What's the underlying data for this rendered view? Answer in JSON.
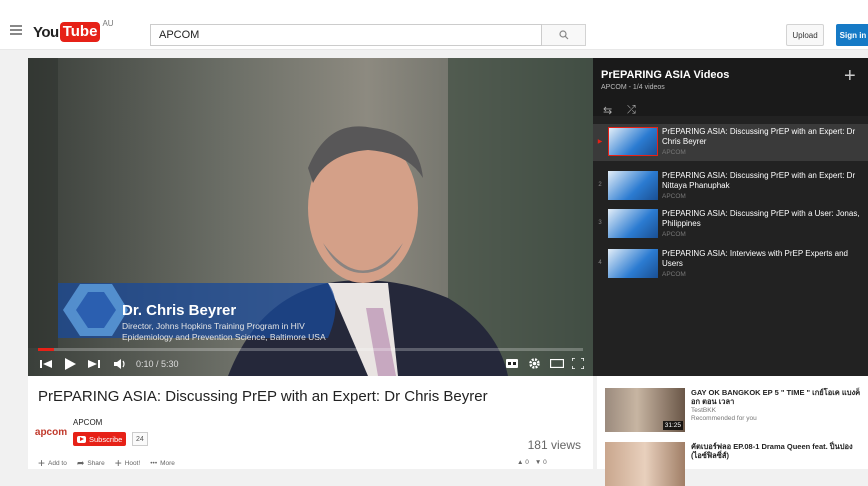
{
  "header": {
    "logo_you": "You",
    "logo_tube": "Tube",
    "country": "AU",
    "search_value": "APCOM",
    "upload_label": "Upload",
    "signin_label": "Sign in"
  },
  "player": {
    "time": "0:10 / 5:30",
    "progress_fraction": 0.03,
    "lower_third_name": "Dr. Chris Beyrer",
    "lower_third_sub": "Director, Johns Hopkins Training Program in HIV Epidemiology and Prevention Science, Baltimore USA"
  },
  "playlist": {
    "title": "PrEPARING ASIA Videos",
    "subtitle": "APCOM - 1/4 videos",
    "items": [
      {
        "index": "▶",
        "title": "PrEPARING ASIA: Discussing PrEP with an Expert: Dr Chris Beyrer",
        "channel": "APCOM"
      },
      {
        "index": "2",
        "title": "PrEPARING ASIA: Discussing PrEP with an Expert: Dr Nittaya Phanuphak",
        "channel": "APCOM"
      },
      {
        "index": "3",
        "title": "PrEPARING ASIA: Discussing PrEP with a User: Jonas, Philippines",
        "channel": "APCOM"
      },
      {
        "index": "4",
        "title": "PrEPARING ASIA: Interviews with PrEP Experts and Users",
        "channel": "APCOM"
      }
    ]
  },
  "video": {
    "title": "PrEPARING ASIA: Discussing PrEP with an Expert: Dr Chris Beyrer",
    "channel_logo": "apcom",
    "channel_name": "APCOM",
    "subscribe_label": "Subscribe",
    "subscriber_count": "24",
    "views": "181 views",
    "actions": [
      "Add to",
      "Share",
      "Hoot!"
    ],
    "more_label": "More",
    "likes": "0",
    "dislikes": "0"
  },
  "recommendations": [
    {
      "title": "GAY OK BANGKOK EP 5 \" TIME \" เกย์โอเค แบงค็อก ตอน เวลา",
      "channel": "TestBKK",
      "meta": "Recommended for you",
      "duration": "31:25"
    },
    {
      "title": "คัตเบอร์ฟลอ EP.08-1 Drama Queen feat. ปิ่นปอง (ไอซ์ฟิลซิ่ส์)",
      "channel": "",
      "meta": "",
      "duration": ""
    }
  ],
  "colors": {
    "brand_red": "#e62117",
    "signin_blue": "#167ac6"
  }
}
